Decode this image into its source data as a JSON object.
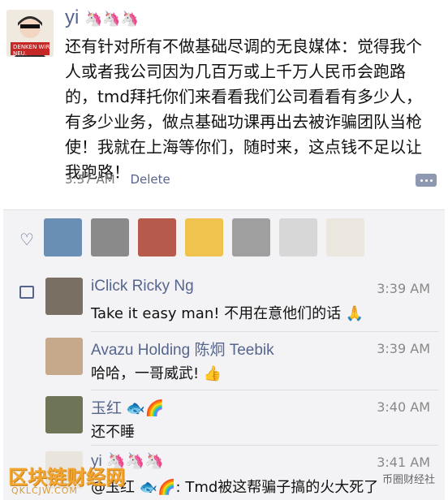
{
  "post": {
    "author": "yi",
    "author_emojis": "🦄🦄🦄",
    "avatar_badge": "DENKEN WIR NEU.",
    "text": "还有针对所有不做基础尽调的无良媒体：觉得我个人或者我公司因为几百万或上千万人民币会跑路的，tmd拜托你们来看看我们公司看看有多少人，有多少业务，做点基础功课再出去被诈骗团队当枪使！我就在上海等你们，随时来，这点钱不足以让我跑路！",
    "time": "3:37 AM",
    "delete_label": "Delete"
  },
  "likes": {
    "heart_icon": "heart-icon",
    "thumbnails": [
      {
        "color": "#6a8fb4"
      },
      {
        "color": "#8a8a8a"
      },
      {
        "color": "#b65b4b"
      },
      {
        "color": "#f0c34e"
      },
      {
        "color": "#9f9f9f"
      },
      {
        "color": "#d7d7d7"
      },
      {
        "color": "#ebe7df"
      }
    ]
  },
  "comments": [
    {
      "name": "iClick Ricky Ng",
      "time": "3:39 AM",
      "text": "Take it easy man! 不用在意他们的话 🙏",
      "avatar_color": "#7a6f63"
    },
    {
      "name": "Avazu Holding 陈炯 Teebik",
      "time": "3:39 AM",
      "text": "哈哈，一哥威武! 👍",
      "avatar_color": "#c6a98b"
    },
    {
      "name": "玉红 🐟🌈",
      "time": "3:40 AM",
      "text": "还不睡",
      "avatar_color": "#6e7456"
    },
    {
      "name": "yi 🦄🦄🦄",
      "time": "3:41 AM",
      "text": "@玉红 🐟🌈: Tmd被这帮骗子搞的火大死了",
      "avatar_color": "#e9e4dc"
    }
  ],
  "watermark": {
    "left": "区块链财经网",
    "left_sub": "QKLCJW.COM",
    "right": "币圈财经社"
  }
}
